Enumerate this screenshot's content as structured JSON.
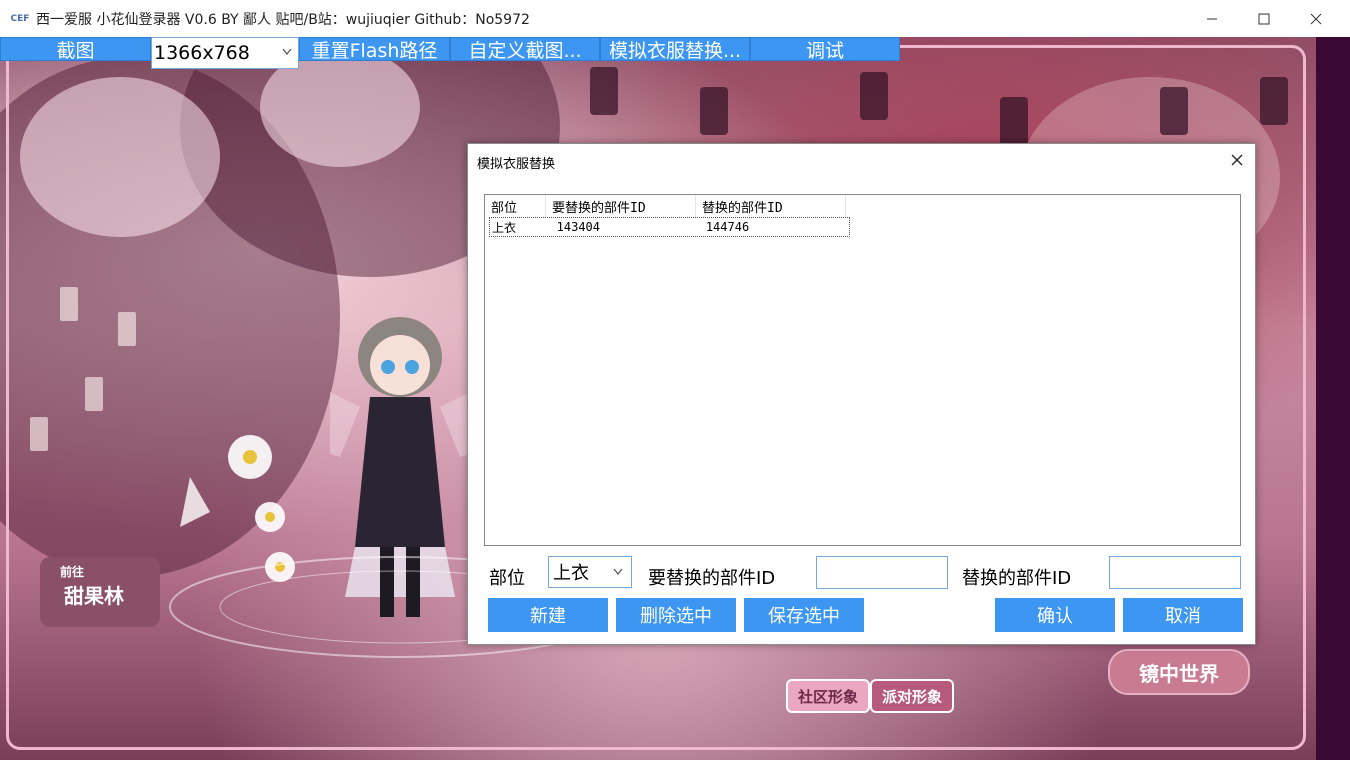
{
  "window": {
    "title": "西一爱服 小花仙登录器 V0.6 BY 鄙人 贴吧/B站：wujiuqier Github：No5972",
    "app_icon_text": "CEF",
    "minimize_icon": "minimize-icon",
    "maximize_icon": "maximize-icon",
    "close_icon": "close-icon"
  },
  "toolbar": {
    "screenshot_label": "截图",
    "resolution_value": "1366x768",
    "reset_flash_label": "重置Flash路径",
    "custom_screenshot_label": "自定义截图...",
    "clothes_replace_label": "模拟衣服替换...",
    "debug_label": "调试",
    "accent_color": "#3d96f2"
  },
  "game": {
    "community_label": "社区形象",
    "party_label": "派对形象",
    "mirror_label": "镜中世界",
    "sweet_forest_prefix": "前往",
    "sweet_forest_label": "甜果林"
  },
  "dialog": {
    "title": "模拟衣服替换",
    "columns": [
      "部位",
      "要替换的部件ID",
      "替换的部件ID"
    ],
    "rows": [
      {
        "part": "上衣",
        "target_id": "143404",
        "replacement_id": "144746"
      }
    ],
    "part_label": "部位",
    "part_value": "上衣",
    "target_id_label": "要替换的部件ID",
    "replacement_id_label": "替换的部件ID",
    "target_id_value": "",
    "replacement_id_value": "",
    "new_button": "新建",
    "delete_button": "删除选中",
    "save_button": "保存选中",
    "confirm_button": "确认",
    "cancel_button": "取消"
  }
}
